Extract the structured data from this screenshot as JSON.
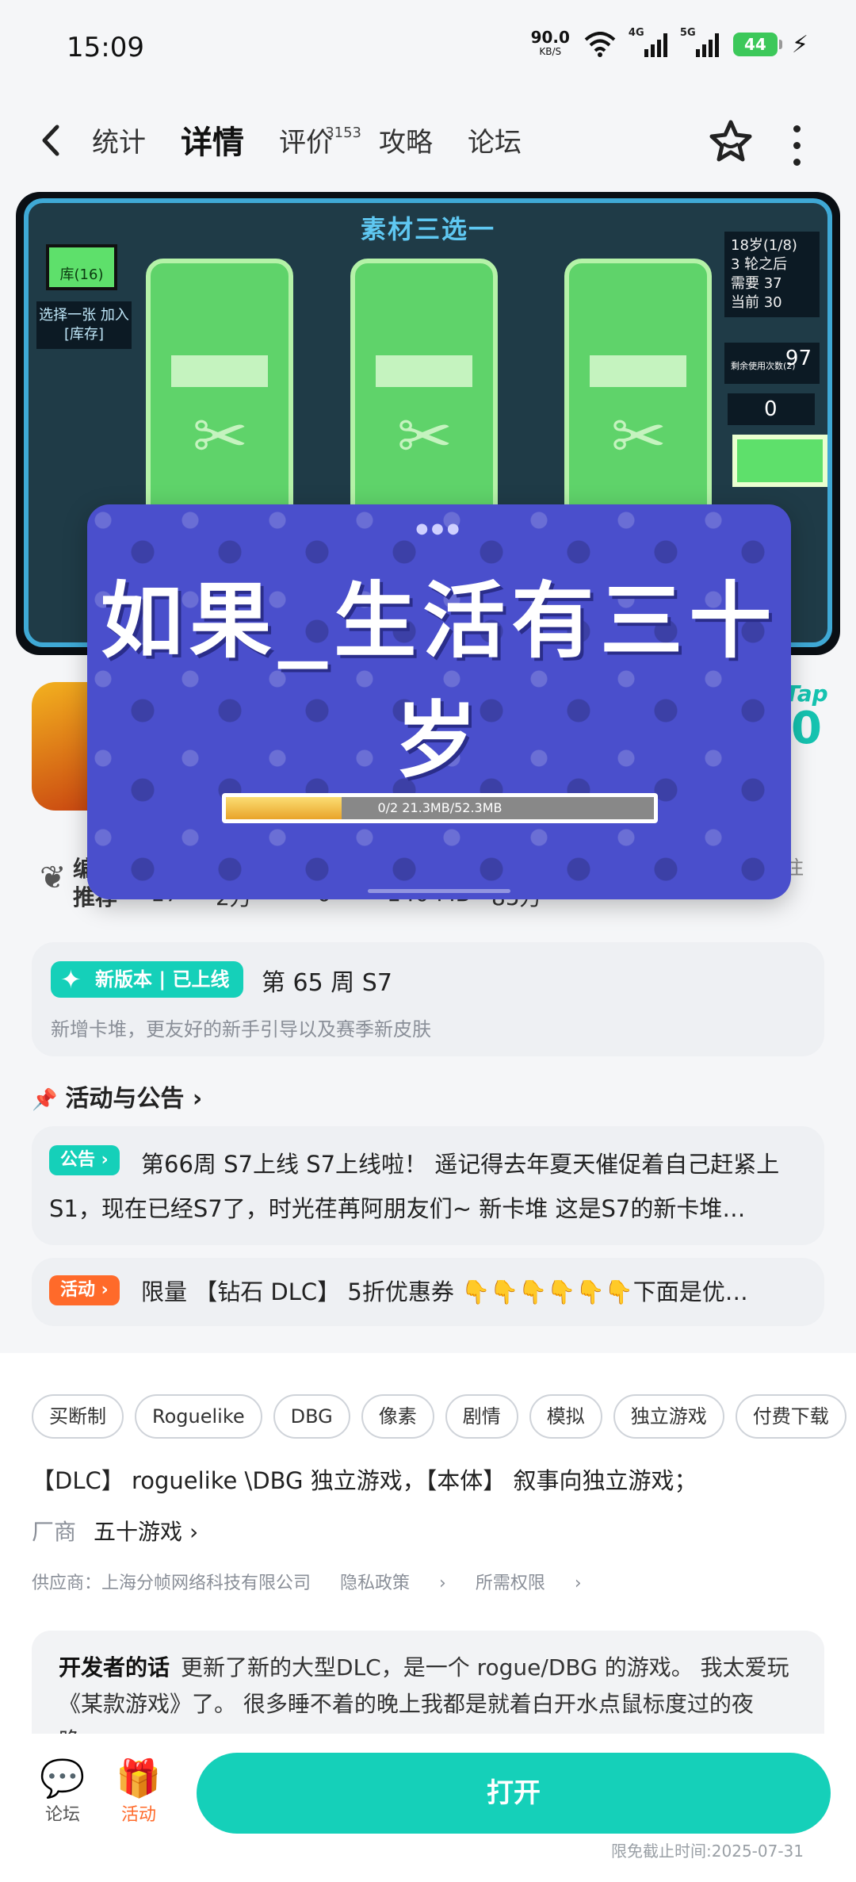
{
  "status_bar": {
    "time": "15:09",
    "net_speed": "90.0",
    "net_unit": "KB/S",
    "sig1_label": "4G",
    "sig2_label": "5G",
    "battery": "44"
  },
  "nav": {
    "tabs": [
      {
        "label": "统计",
        "active": false
      },
      {
        "label": "详情",
        "active": true
      },
      {
        "label": "评价",
        "badge": "3153",
        "active": false
      },
      {
        "label": "攻略",
        "active": false
      },
      {
        "label": "论坛",
        "active": false
      }
    ]
  },
  "banner": {
    "title": "素材三选一",
    "library": "库(16)",
    "hint": "选择一张 加入[库存]",
    "stats": [
      "18岁(1/8)",
      "3 轮之后",
      "需要 37",
      "当前 30"
    ],
    "counter_value": "97",
    "counter_label": "剩余使用次数(2)",
    "zero_value": "0"
  },
  "overlay": {
    "title": "如果_生活有三十岁",
    "progress_text": "0/2  21.3MB/52.3MB",
    "progress_fraction": 0.27
  },
  "app_info": {
    "tap_logo": "Tap",
    "score": "0",
    "award_label_top": "编",
    "award_label": "推荐",
    "cols": [
      "17",
      "2万",
      "0",
      "140 MB",
      "85万"
    ],
    "follow": "注"
  },
  "version": {
    "badge": "新版本 | 已上线",
    "title": "第 65 周 S7",
    "desc": "新增卡堆，更友好的新手引导以及赛季新皮肤"
  },
  "section_title": "活动与公告",
  "notice": {
    "tag": "公告",
    "text": "第66周 S7上线 S7上线啦！ 遥记得去年夏天催促着自己赶紧上S1，现在已经S7了，时光荏苒阿朋友们~ 新卡堆 这是S7的新卡堆…"
  },
  "activity": {
    "tag": "活动",
    "text": "限量 【钻石 DLC】 5折优惠券 👇👇👇👇👇👇下面是优…"
  },
  "tags": [
    "买断制",
    "Roguelike",
    "DBG",
    "像素",
    "剧情",
    "模拟",
    "独立游戏",
    "付费下载"
  ],
  "intro": "【DLC】 roguelike \\DBG 独立游戏，【本体】 叙事向独立游戏；",
  "vendor": {
    "label": "厂商",
    "name": "五十游戏"
  },
  "supplier": {
    "text": "供应商：上海分帧网络科技有限公司",
    "privacy": "隐私政策",
    "permissions": "所需权限"
  },
  "developer": {
    "label": "开发者的话",
    "text": "更新了新的大型DLC，是一个 rogue/DBG 的游戏。 我太爱玩《某款游戏》了。 很多睡不着的晚上我都是就着白开水点鼠标度过的夜晚……"
  },
  "bottom_bar": {
    "forum": "论坛",
    "activity": "活动",
    "open": "打开",
    "deadline": "限免截止时间:2025-07-31"
  }
}
